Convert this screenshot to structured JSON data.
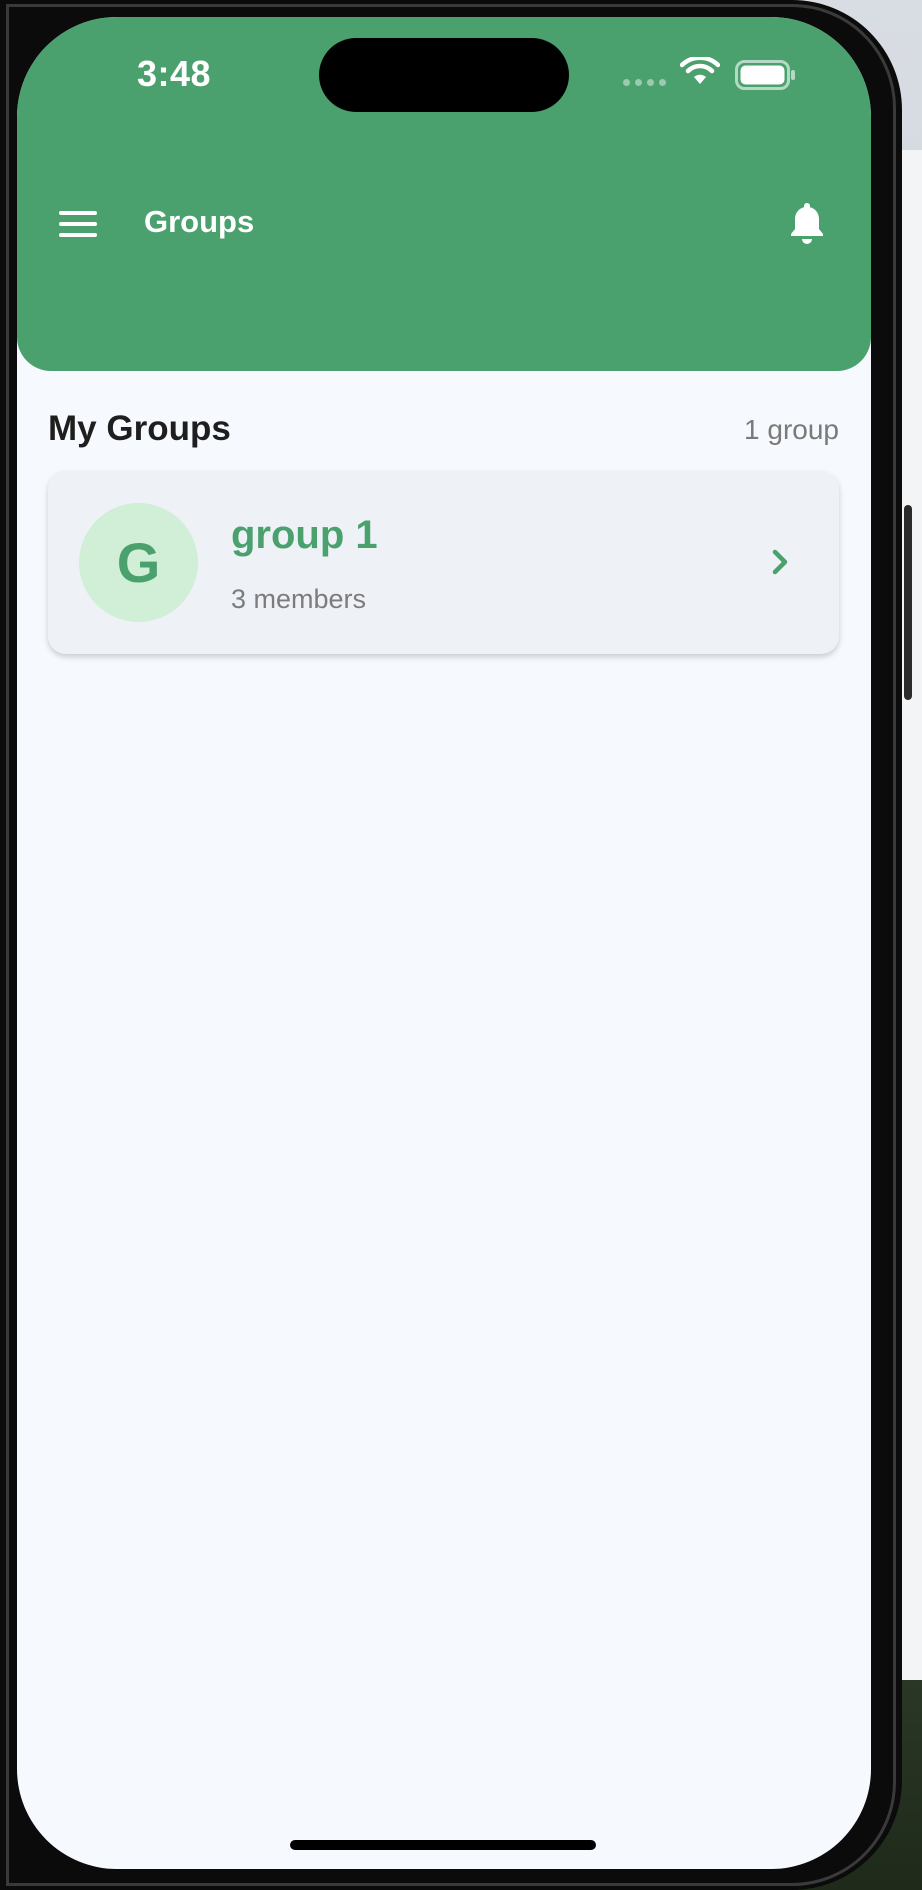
{
  "status_bar": {
    "time": "3:48"
  },
  "header": {
    "title": "Groups",
    "background_color": "#4aa16e"
  },
  "section": {
    "title": "My Groups",
    "count": "1 group"
  },
  "groups": [
    {
      "avatar_letter": "G",
      "name": "group 1",
      "members": "3 members"
    }
  ],
  "icons": {
    "menu": "hamburger-menu-icon",
    "notifications": "bell-icon",
    "open": "chevron-right-icon",
    "wifi": "wifi-icon",
    "battery": "battery-icon"
  },
  "colors": {
    "accent": "#4aa16e",
    "avatar_bg": "#d1eed6",
    "card_bg": "#eef2f7",
    "screen_bg": "#f6f9fe"
  }
}
